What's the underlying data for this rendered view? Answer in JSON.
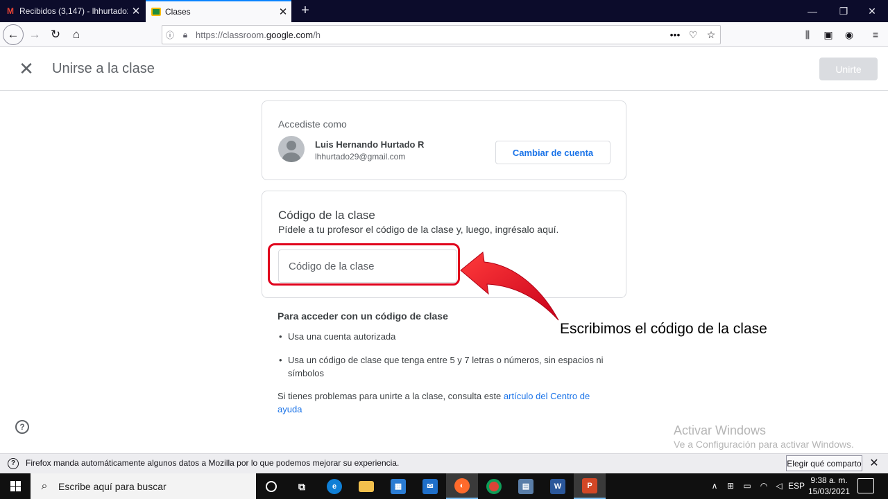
{
  "browser": {
    "tabs": [
      {
        "title": "Recibidos (3,147) - lhhurtado29",
        "favicon": "gmail-icon"
      },
      {
        "title": "Clases",
        "favicon": "classroom-icon"
      }
    ],
    "url_prefix": "https://classroom.",
    "url_domain": "google.com",
    "url_suffix": "/h",
    "notification": {
      "text": "Firefox manda automáticamente algunos datos a Mozilla por lo que podemos mejorar su experiencia.",
      "button": "Elegir qué comparto"
    }
  },
  "header": {
    "title": "Unirse a la clase",
    "join_button": "Unirte"
  },
  "account": {
    "label": "Accediste como",
    "name": "Luis Hernando Hurtado R",
    "email": "lhhurtado29@gmail.com",
    "switch_button": "Cambiar de cuenta"
  },
  "class_code": {
    "title": "Código de la clase",
    "subtitle": "Pídele a tu profesor el código de la clase y, luego, ingrésalo aquí.",
    "placeholder": "Código de la clase"
  },
  "info": {
    "title": "Para acceder con un código de clase",
    "items": [
      "Usa una cuenta autorizada",
      "Usa un código de clase que tenga entre 5 y 7 letras o números, sin espacios ni símbolos"
    ],
    "help_prefix": "Si tienes problemas para unirte a la clase, consulta este ",
    "help_link": "artículo del Centro de ayuda"
  },
  "annotation": {
    "text": "Escribimos el código de la clase",
    "color": "#e0001b"
  },
  "watermark": {
    "line1": "Activar Windows",
    "line2": "Ve a Configuración para activar Windows."
  },
  "taskbar": {
    "search_placeholder": "Escribe aquí para buscar",
    "language": "ESP",
    "time": "9:38 a. m.",
    "date": "15/03/2021"
  },
  "colors": {
    "accent": "#1a73e8",
    "tab_strip": "#0c0c2b",
    "taskbar": "#101010"
  }
}
